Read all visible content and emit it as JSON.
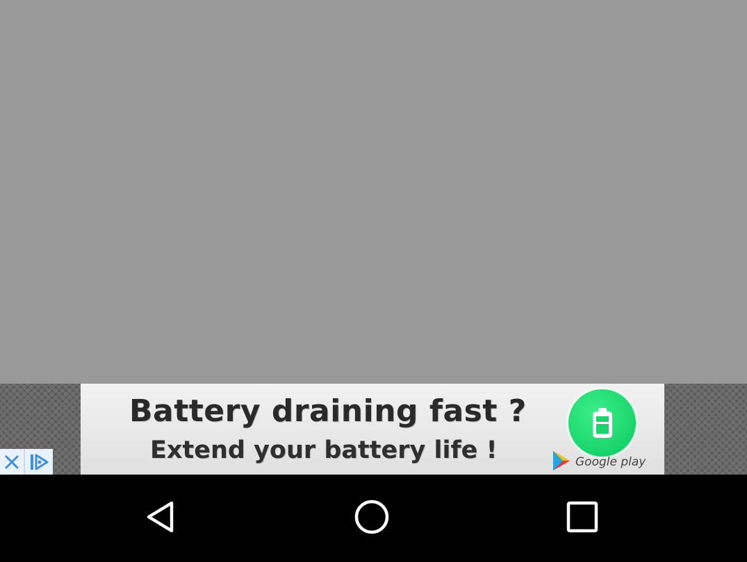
{
  "screen": {
    "background_color": "#999999"
  },
  "ad": {
    "headline": "Battery draining fast ?",
    "subline": "Extend your battery life !",
    "store_label": "Google play",
    "accent_color": "#19d46b",
    "icons": [
      "battery-icon",
      "google-play-icon",
      "close-icon",
      "ad-choices-icon"
    ]
  },
  "nav": {
    "buttons": [
      {
        "name": "back",
        "icon": "back-triangle-icon"
      },
      {
        "name": "home",
        "icon": "home-circle-icon"
      },
      {
        "name": "recents",
        "icon": "recents-square-icon"
      }
    ]
  }
}
